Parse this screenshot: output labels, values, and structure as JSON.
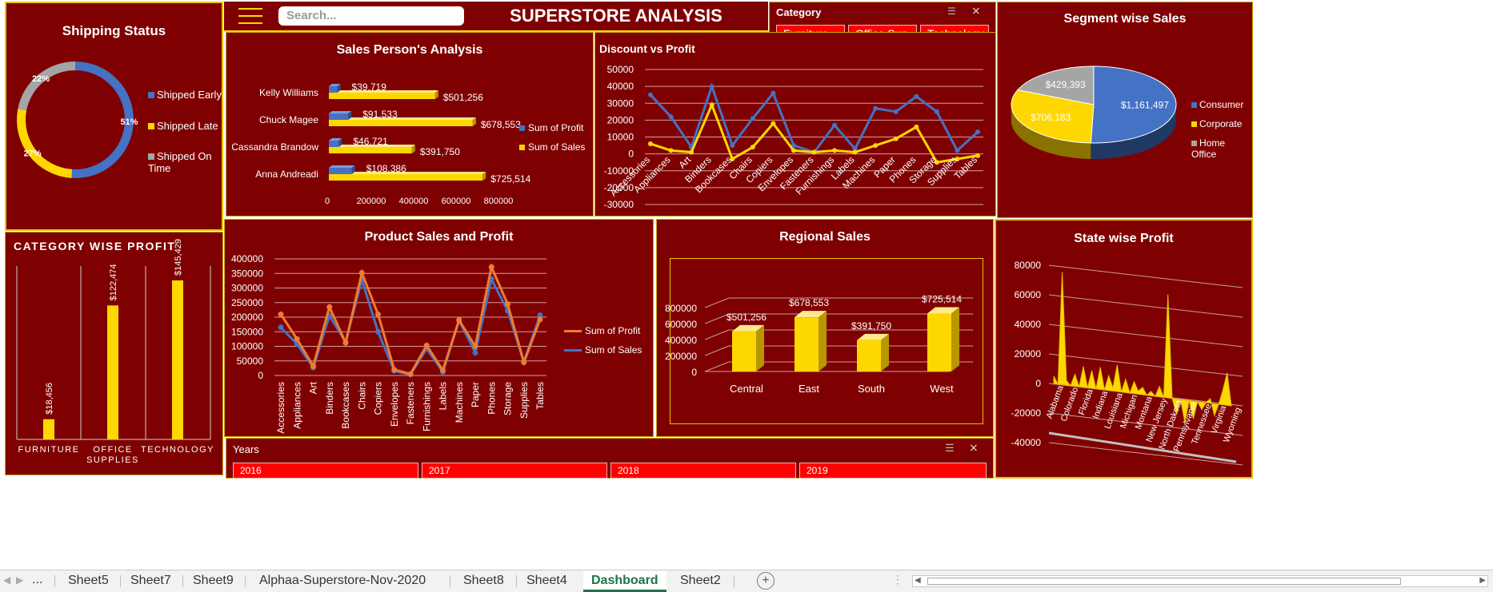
{
  "header": {
    "title": "SUPERSTORE ANALYSIS",
    "search_placeholder": "Search..."
  },
  "category_slicer": {
    "title": "Category",
    "items": [
      "Furniture",
      "Office Sup...",
      "Technology"
    ]
  },
  "years_slicer": {
    "title": "Years",
    "items": [
      "2016",
      "2017",
      "2018",
      "2019"
    ]
  },
  "colors": {
    "panel_bg": "#7f0000",
    "gold": "#ffd700",
    "blue": "#4472c4",
    "gray": "#a5a5a5",
    "orange": "#ed7d31",
    "slicer_red": "#ff0000"
  },
  "shipping_status": {
    "title": "Shipping Status",
    "slices": [
      {
        "label": "Shipped Early",
        "percent": 51,
        "pct_label": "51%",
        "color": "#4472c4"
      },
      {
        "label": "Shipped Late",
        "percent": 27,
        "pct_label": "27%",
        "color": "#ffd700"
      },
      {
        "label": "Shipped On Time",
        "percent": 22,
        "pct_label": "22%",
        "color": "#a5a5a5"
      }
    ]
  },
  "category_profit": {
    "title": "CATEGORY WISE PROFIT",
    "categories": [
      "FURNITURE",
      "OFFICE SUPPLIES",
      "TECHNOLOGY"
    ],
    "values": [
      18456,
      122474,
      145429
    ],
    "labels": [
      "$18,456",
      "$122,474",
      "$145,429"
    ]
  },
  "sales_person": {
    "title": "Sales Person's Analysis",
    "people": [
      "Kelly Williams",
      "Chuck Magee",
      "Cassandra Brandow",
      "Anna Andreadi"
    ],
    "profit": [
      39719,
      91533,
      46721,
      108386
    ],
    "sales": [
      501256,
      678553,
      391750,
      725514
    ],
    "profit_labels": [
      "$39,719",
      "$91,533",
      "$46,721",
      "$108,386"
    ],
    "sales_labels": [
      "$501,256",
      "$678,553",
      "$391,750",
      "$725,514"
    ],
    "x_ticks": [
      "0",
      "200000",
      "400000",
      "600000",
      "800000"
    ],
    "legend": [
      "Sum of Profit",
      "Sum of Sales"
    ]
  },
  "chart_data": [
    {
      "type": "line",
      "title": "Discount vs Profit",
      "categories": [
        "Accessories",
        "Appliances",
        "Art",
        "Binders",
        "Bookcases",
        "Chairs",
        "Copiers",
        "Envelopes",
        "Fasteners",
        "Furnishings",
        "Labels",
        "Machines",
        "Paper",
        "Phones",
        "Storage",
        "Supplies",
        "Tables"
      ],
      "series": [
        {
          "values": [
            35000,
            22000,
            4000,
            40000,
            5000,
            21000,
            36000,
            5000,
            1000,
            17000,
            3000,
            27000,
            25000,
            34000,
            25000,
            2000,
            13000
          ]
        },
        {
          "values": [
            6000,
            2000,
            1000,
            29000,
            -3000,
            4000,
            18000,
            2000,
            1000,
            2000,
            1000,
            5000,
            9000,
            16000,
            -5000,
            -3000,
            -1000
          ]
        }
      ],
      "y_ticks": [
        "50000",
        "40000",
        "30000",
        "20000",
        "10000",
        "0",
        "-10000",
        "-20000",
        "-30000"
      ],
      "ylim": [
        -30000,
        50000
      ]
    },
    {
      "type": "line",
      "title": "Product Sales and Profit",
      "categories": [
        "Accessories",
        "Appliances",
        "Art",
        "Binders",
        "Bookcases",
        "Chairs",
        "Copiers",
        "Envelopes",
        "Fasteners",
        "Furnishings",
        "Labels",
        "Machines",
        "Paper",
        "Phones",
        "Storage",
        "Supplies",
        "Tables"
      ],
      "series": [
        {
          "name": "Sum of Profit",
          "values": [
            210000,
            125000,
            32000,
            235000,
            112000,
            352000,
            210000,
            20000,
            5000,
            103000,
            18000,
            190000,
            100000,
            372000,
            245000,
            45000,
            192000
          ]
        },
        {
          "name": "Sum of Sales",
          "values": [
            165000,
            108000,
            27000,
            205000,
            115000,
            328000,
            150000,
            16000,
            3000,
            92000,
            12000,
            189000,
            78000,
            330000,
            222000,
            47000,
            207000
          ]
        }
      ],
      "y_ticks": [
        "400000",
        "350000",
        "300000",
        "250000",
        "200000",
        "150000",
        "100000",
        "50000",
        "0"
      ],
      "ylim": [
        0,
        400000
      ]
    },
    {
      "type": "bar",
      "title": "Regional Sales",
      "categories": [
        "Central",
        "East",
        "South",
        "West"
      ],
      "values": [
        501256,
        678553,
        391750,
        725514
      ],
      "labels": [
        "$501,256",
        "$678,553",
        "$391,750",
        "$725,514"
      ],
      "y_ticks": [
        "800000",
        "600000",
        "400000",
        "200000",
        "0"
      ],
      "ylim": [
        0,
        800000
      ]
    },
    {
      "type": "pie",
      "title": "Segment wise Sales",
      "categories": [
        "Consumer",
        "Corporate",
        "Home Office"
      ],
      "values": [
        1161497,
        706183,
        429393
      ],
      "labels": [
        "$1,161,497",
        "$706,183",
        "$429,393"
      ]
    },
    {
      "type": "area",
      "title": "State wise Profit",
      "states": [
        "Alabama",
        "Colorado",
        "Florida",
        "Indiana",
        "Louisiana",
        "Michigan",
        "Montana",
        "New Jersey",
        "North Dakota",
        "Pennsylvania",
        "Tennessee",
        "Virginia",
        "Wyoming"
      ],
      "values": [
        5000,
        0,
        76000,
        3000,
        0,
        8000,
        0,
        14000,
        0,
        12000,
        0,
        15000,
        0,
        10000,
        2000,
        18000,
        0,
        9000,
        0,
        8000,
        2000,
        5000,
        0,
        3000,
        0,
        7000,
        0,
        70000,
        0,
        -10000,
        0,
        -15000,
        0,
        -12000,
        0,
        -5000,
        0,
        3000,
        -8000,
        0,
        10000,
        22000,
        0
      ],
      "y_ticks": [
        "80000",
        "60000",
        "40000",
        "20000",
        "0",
        "-20000",
        "-40000"
      ],
      "ylim": [
        -40000,
        80000
      ]
    }
  ],
  "sheet_tabs": [
    "Sheet5",
    "Sheet7",
    "Sheet9",
    "Alphaa-Superstore-Nov-2020",
    "Sheet8",
    "Sheet4",
    "Dashboard",
    "Sheet2"
  ],
  "active_tab": "Dashboard",
  "tab_ellipsis": "...",
  "add_sheet": "+"
}
